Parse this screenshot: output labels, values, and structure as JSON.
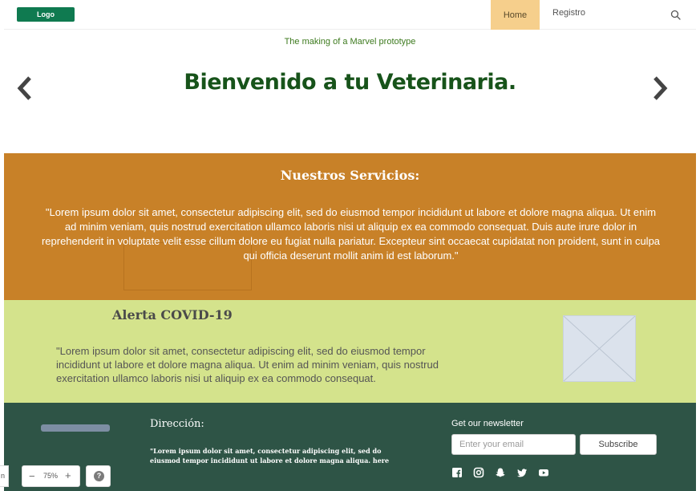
{
  "header": {
    "logo": "Logo",
    "nav": {
      "home": "Home",
      "registro": "Registro"
    },
    "search_icon": "search-icon"
  },
  "hero": {
    "subtitle": "The making of a Marvel prototype",
    "title": "Bienvenido a tu Veterinaria."
  },
  "services": {
    "title": "Nuestros Servicios:",
    "text": "\"Lorem ipsum dolor sit amet, consectetur adipiscing elit, sed do eiusmod tempor incididunt ut labore et dolore magna aliqua. Ut enim ad minim veniam, quis nostrud exercitation ullamco laboris nisi ut aliquip ex ea commodo consequat. Duis aute irure dolor in reprehenderit in voluptate velit esse cillum dolore eu fugiat nulla pariatur. Excepteur sint occaecat cupidatat non proident, sunt in culpa qui officia deserunt mollit anim id est laborum.\""
  },
  "covid": {
    "title": "Alerta COVID-19",
    "text": "\"Lorem ipsum dolor sit amet, consectetur adipiscing elit, sed do eiusmod tempor incididunt ut labore et dolore magna aliqua. Ut enim ad minim veniam, quis nostrud exercitation ullamco laboris nisi ut aliquip ex ea commodo consequat."
  },
  "footer": {
    "direccion_title": "Dirección:",
    "direccion_text": "\"Lorem ipsum dolor sit amet, consectetur adipiscing elit, sed do eiusmod tempor incididunt ut labore et dolore magna aliqua. here",
    "newsletter_title": "Get our newsletter",
    "email_placeholder": "Enter your email",
    "subscribe_label": "Subscribe",
    "social_icons": [
      "facebook-icon",
      "instagram-icon",
      "snapchat-icon",
      "twitter-icon",
      "youtube-icon"
    ]
  },
  "zoom": {
    "minus": "−",
    "level": "75%",
    "plus": "+",
    "help": "?",
    "edge_label": "n"
  },
  "colors": {
    "logo_bg": "#0f7a50",
    "home_tab": "#f6cf8c",
    "services_bg": "#c88128",
    "covid_bg": "#d4e38c",
    "footer_bg": "#2e5446",
    "title_green": "#17531a"
  }
}
